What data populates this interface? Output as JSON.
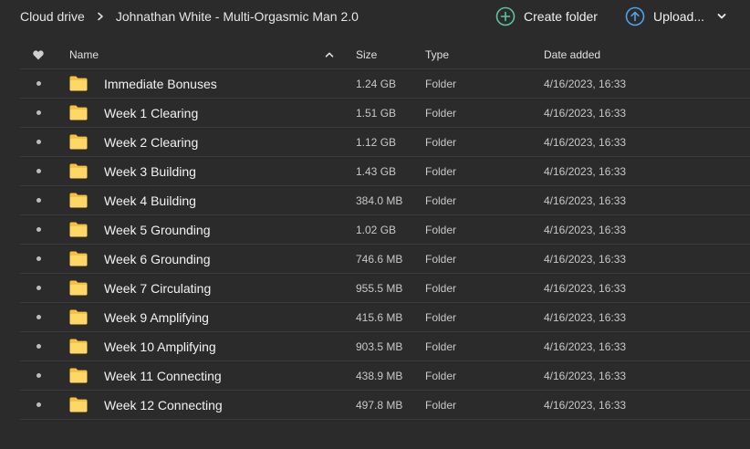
{
  "breadcrumb": {
    "root": "Cloud drive",
    "current": "Johnathan White - Multi-Orgasmic Man 2.0"
  },
  "actions": {
    "create_folder": "Create folder",
    "upload": "Upload..."
  },
  "colors": {
    "background": "#2b2b2b",
    "create_accent": "#5cc4a0",
    "upload_accent": "#4fa3e8",
    "folder": "#f5c542"
  },
  "table": {
    "headers": {
      "name": "Name",
      "size": "Size",
      "type": "Type",
      "date": "Date added"
    },
    "rows": [
      {
        "name": "Immediate Bonuses",
        "size": "1.24 GB",
        "type": "Folder",
        "date": "4/16/2023, 16:33"
      },
      {
        "name": "Week 1 Clearing",
        "size": "1.51 GB",
        "type": "Folder",
        "date": "4/16/2023, 16:33"
      },
      {
        "name": "Week 2 Clearing",
        "size": "1.12 GB",
        "type": "Folder",
        "date": "4/16/2023, 16:33"
      },
      {
        "name": "Week 3 Building",
        "size": "1.43 GB",
        "type": "Folder",
        "date": "4/16/2023, 16:33"
      },
      {
        "name": "Week 4 Building",
        "size": "384.0 MB",
        "type": "Folder",
        "date": "4/16/2023, 16:33"
      },
      {
        "name": "Week 5 Grounding",
        "size": "1.02 GB",
        "type": "Folder",
        "date": "4/16/2023, 16:33"
      },
      {
        "name": "Week 6 Grounding",
        "size": "746.6 MB",
        "type": "Folder",
        "date": "4/16/2023, 16:33"
      },
      {
        "name": "Week 7 Circulating",
        "size": "955.5 MB",
        "type": "Folder",
        "date": "4/16/2023, 16:33"
      },
      {
        "name": "Week 9 Amplifying",
        "size": "415.6 MB",
        "type": "Folder",
        "date": "4/16/2023, 16:33"
      },
      {
        "name": "Week 10 Amplifying",
        "size": "903.5 MB",
        "type": "Folder",
        "date": "4/16/2023, 16:33"
      },
      {
        "name": "Week 11 Connecting",
        "size": "438.9 MB",
        "type": "Folder",
        "date": "4/16/2023, 16:33"
      },
      {
        "name": "Week 12 Connecting",
        "size": "497.8 MB",
        "type": "Folder",
        "date": "4/16/2023, 16:33"
      }
    ]
  }
}
